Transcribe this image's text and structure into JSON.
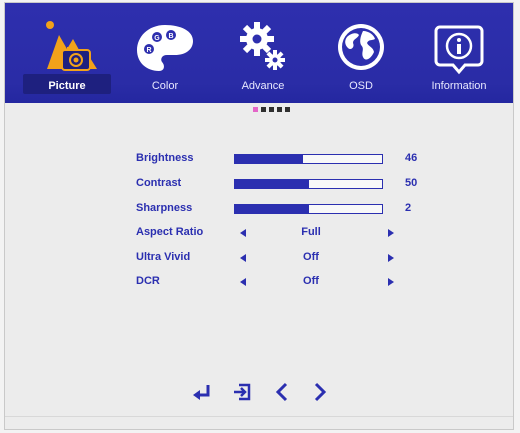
{
  "tabs": [
    {
      "label": "Picture",
      "icon": "picture-icon",
      "active": true
    },
    {
      "label": "Color",
      "icon": "color-palette-icon",
      "active": false
    },
    {
      "label": "Advance",
      "icon": "gears-icon",
      "active": false
    },
    {
      "label": "OSD",
      "icon": "globe-icon",
      "active": false
    },
    {
      "label": "Information",
      "icon": "info-icon",
      "active": false
    }
  ],
  "page_indicator": {
    "total": 5,
    "current": 1
  },
  "settings": {
    "brightness": {
      "label": "Brightness",
      "value": "46",
      "level": 0.46
    },
    "contrast": {
      "label": "Contrast",
      "value": "50",
      "level": 0.5
    },
    "sharpness": {
      "label": "Sharpness",
      "value": "2",
      "level": 0.5
    },
    "aspect_ratio": {
      "label": "Aspect Ratio",
      "value": "Full"
    },
    "ultra_vivid": {
      "label": "Ultra Vivid",
      "value": "Off"
    },
    "dcr": {
      "label": "DCR",
      "value": "Off"
    }
  },
  "nav_keys": [
    "enter-icon",
    "exit-icon",
    "left-chevron-icon",
    "right-chevron-icon"
  ],
  "colors": {
    "header": "#2e2fae",
    "text": "#2b2fb0",
    "active_icon": "#f2a21a",
    "background": "#ececec"
  }
}
